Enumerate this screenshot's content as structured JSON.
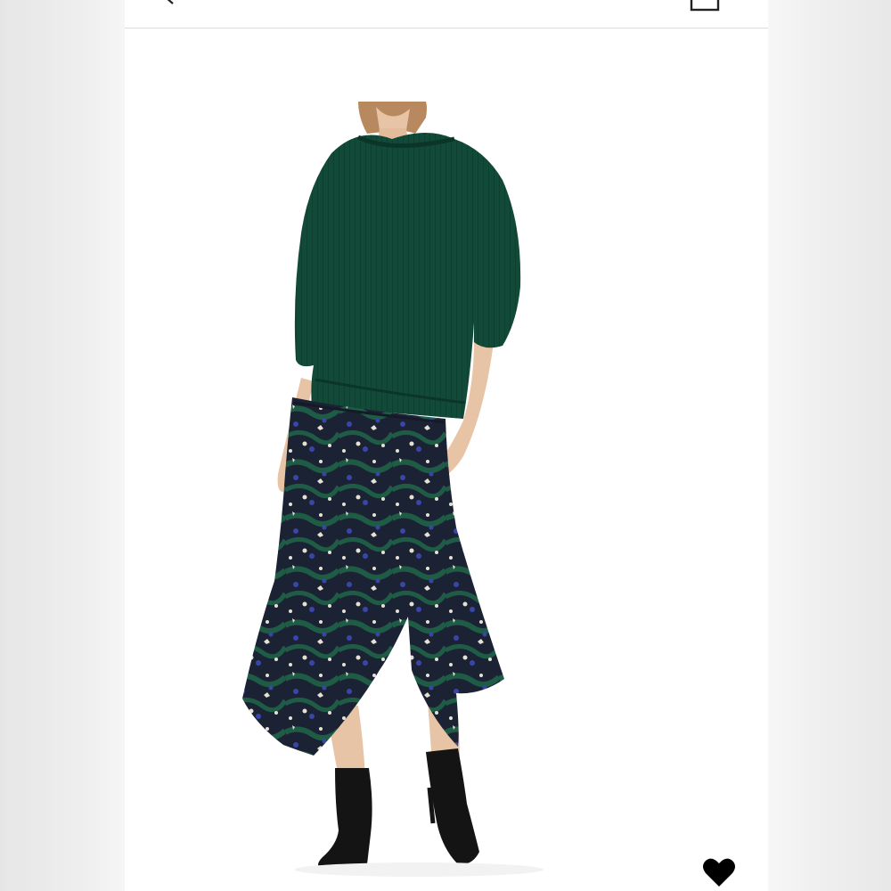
{
  "header": {
    "back_icon": "chevron-left-icon",
    "bag_icon": "shopping-bag-icon"
  },
  "product_image": {
    "subject": "model-wearing-green-sweater-and-printed-midi-skirt",
    "colors": {
      "sweater": "#114a38",
      "skirt_dark": "#1b2233",
      "skirt_green": "#1f5c46",
      "skirt_blue": "#3a45a8",
      "skirt_cream": "#e6e1d4",
      "boots": "#141414"
    }
  },
  "actions": {
    "like_icon": "heart-icon",
    "like_color": "#000000"
  }
}
